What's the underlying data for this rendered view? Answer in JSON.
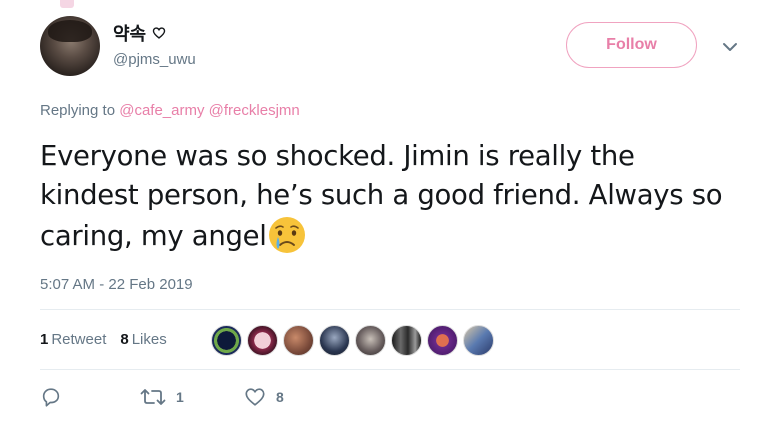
{
  "user": {
    "display_name": "약속",
    "handle": "@pjms_uwu"
  },
  "follow_label": "Follow",
  "replying": {
    "prefix": "Replying to",
    "mention1": "@cafe_army",
    "mention2": "@frecklesjmn"
  },
  "tweet": {
    "text": "Everyone was so shocked. Jimin is really the kindest person, he’s such a good friend. Always so caring, my angel",
    "emoji": "crying-face"
  },
  "timestamp": "5:07 AM - 22 Feb 2019",
  "stats": {
    "retweets_count": "1",
    "retweets_label": "Retweet",
    "likes_count": "8",
    "likes_label": "Likes"
  },
  "actions": {
    "retweet_count": "1",
    "like_count": "8"
  },
  "colors": {
    "accent_pink": "#e87fa8",
    "secondary_text": "#657786",
    "primary_text": "#14171a"
  },
  "icons": [
    "heart-outline-icon",
    "chevron-down-icon",
    "reply-icon",
    "retweet-icon",
    "like-icon",
    "crying-face-emoji"
  ]
}
